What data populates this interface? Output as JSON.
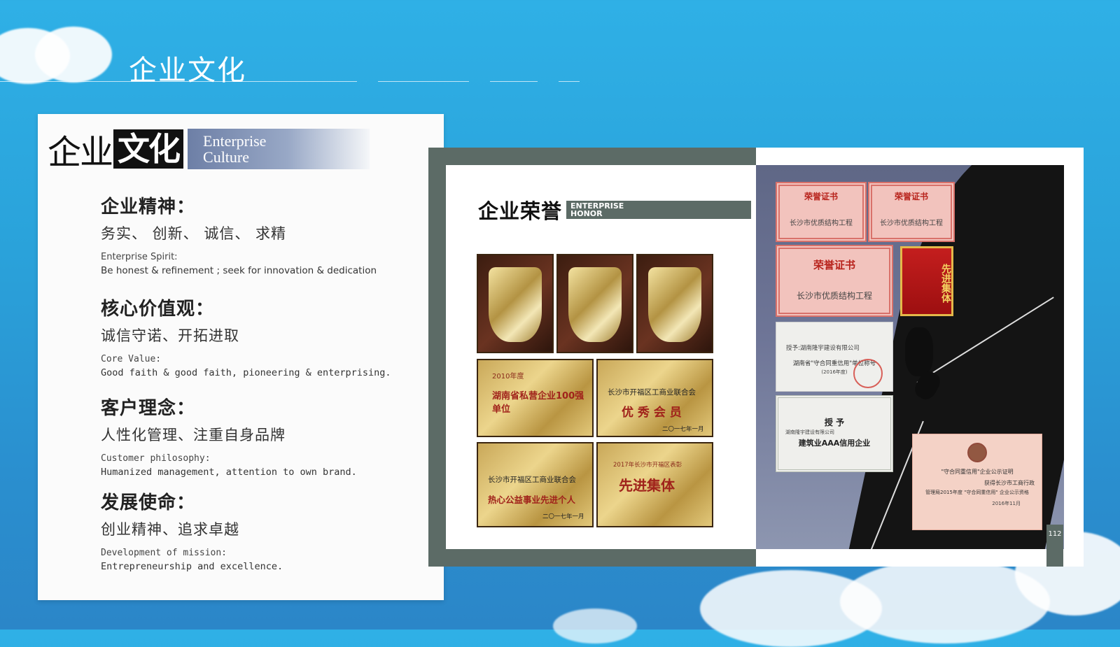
{
  "slide": {
    "title": "企业文化"
  },
  "culture": {
    "heading_cn_part1": "企业",
    "heading_cn_part2": "文化",
    "heading_en_line1": "Enterprise",
    "heading_en_line2": "Culture",
    "sections": [
      {
        "heading": "企业精神：",
        "cn": "务实、 创新、 诚信、 求精",
        "en_label": "Enterprise Spirit:",
        "en_text": "Be honest & refinement ; seek for innovation & dedication"
      },
      {
        "heading": "核心价值观：",
        "cn": "诚信守诺、开拓进取",
        "en_label": "Core Value:",
        "en_text": "Good faith & good faith, pioneering & enterprising."
      },
      {
        "heading": "客户理念：",
        "cn": "人性化管理、注重自身品牌",
        "en_label": "Customer philosophy:",
        "en_text": "Humanized management, attention to own brand."
      },
      {
        "heading": "发展使命：",
        "cn": "创业精神、追求卓越",
        "en_label": "Development of mission:",
        "en_text": "Entrepreneurship and excellence."
      }
    ]
  },
  "honor": {
    "heading_cn": "企业荣誉",
    "heading_en_line1": "ENTERPRISE",
    "heading_en_line2": "HONOR",
    "plaques": [
      {
        "line1": "2010年度",
        "line2": "湖南省私营企业100强单位"
      },
      {
        "line1": "长沙市开福区工商业联合会",
        "line2": "优 秀 会 员",
        "line3": "二〇一七年一月"
      },
      {
        "line1": "长沙市开福区工商业联合会",
        "line2": "热心公益事业先进个人",
        "line3": "二〇一七年一月"
      },
      {
        "line1": "2017年长沙市开福区表彰",
        "line2": "先进集体"
      }
    ],
    "certificates": [
      {
        "title": "荣誉证书",
        "body": "长沙市优质结构工程"
      },
      {
        "title": "荣誉证书",
        "body": "长沙市优质结构工程"
      },
      {
        "title": "荣誉证书",
        "body": "长沙市优质结构工程"
      }
    ],
    "banner_text": "先进集体",
    "cert_white_1": {
      "line1": "授予:湖南隆宇建设有限公司",
      "line2": "湖南省\"守合同重信用\"单位称号",
      "line3": "(2016年度)"
    },
    "cert_white_2": {
      "line1": "授 予",
      "line2": "湖南隆宇建设有限公司",
      "line3": "建筑业AAA信用企业"
    },
    "cert_pink": {
      "line1": "\"守合同重信用\"企业公示证明",
      "line2": "获得长沙市工商行政",
      "line3": "管理局2015年度 \"守合同重信用\" 企业公示资格",
      "line4": "2016年11月"
    },
    "page_number": "112"
  }
}
